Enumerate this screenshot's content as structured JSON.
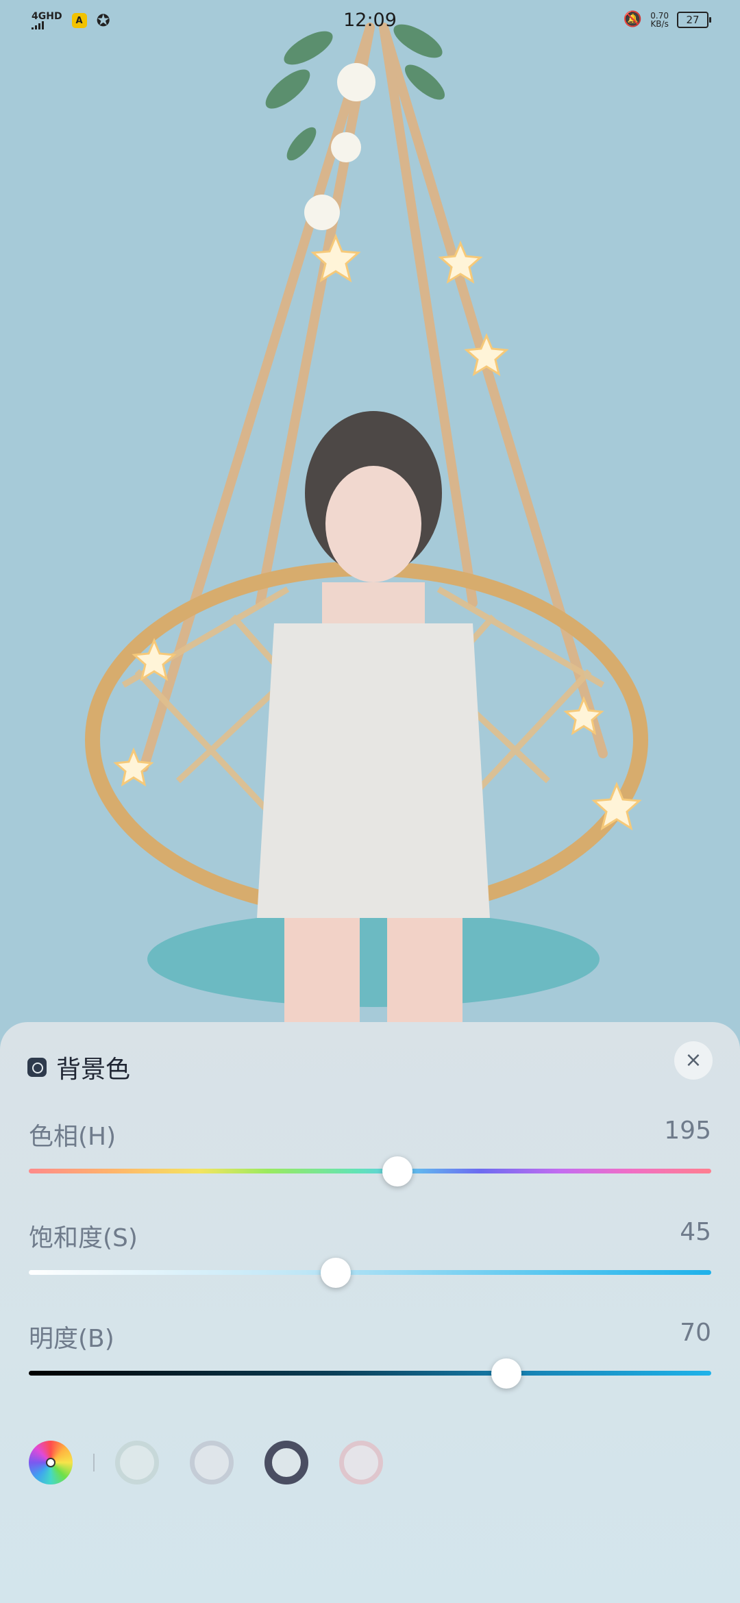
{
  "status_bar": {
    "network": "4GHD",
    "time": "12:09",
    "speed_value": "0.70",
    "speed_unit": "KB/s",
    "battery": "27"
  },
  "panel": {
    "title": "背景色",
    "close_label": "×",
    "sliders": [
      {
        "label": "色相(H)",
        "value": "195",
        "level": 0.54
      },
      {
        "label": "饱和度(S)",
        "value": "45",
        "level": 0.45
      },
      {
        "label": "明度(B)",
        "value": "70",
        "level": 0.7
      }
    ],
    "swatches": [
      {
        "name": "swatch-light-sage",
        "ring": "#c7d8d9",
        "fill": "#dde8ea"
      },
      {
        "name": "swatch-light-gray",
        "ring": "#c4ccd6",
        "fill": "#dfe5ea"
      },
      {
        "name": "swatch-dark-navy",
        "ring": "#4a4e62",
        "fill": "#dde6ea",
        "selected": true
      },
      {
        "name": "swatch-light-pink",
        "ring": "#dfc6cd",
        "fill": "#e5e4e9"
      }
    ]
  },
  "colors": {
    "scene_background": "#a6cad8",
    "accent": "#1fb1ea"
  }
}
